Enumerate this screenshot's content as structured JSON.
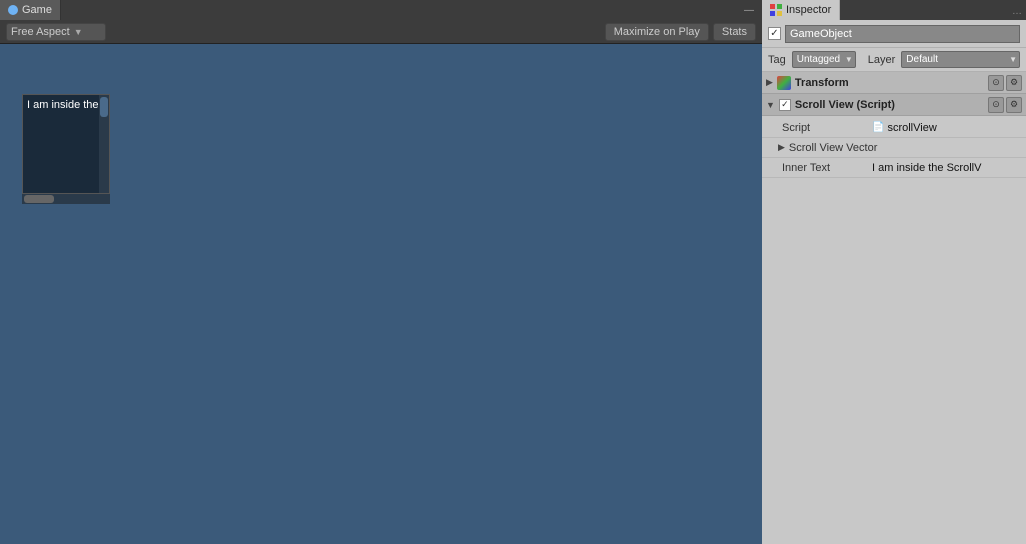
{
  "game_panel": {
    "tab_label": "Game",
    "aspect_label": "Free Aspect",
    "maximize_btn": "Maximize on Play",
    "stats_btn": "Stats",
    "minimize_symbol": "—",
    "scroll_text": "I am inside the"
  },
  "inspector_panel": {
    "tab_label": "Inspector",
    "minimize_symbol": "…",
    "gameobject_name": "GameObject",
    "tag_label": "Tag",
    "tag_value": "Untagged",
    "layer_label": "Layer",
    "layer_value": "Default",
    "transform": {
      "title": "Transform",
      "settings_btn": "⚙"
    },
    "scroll_view_script": {
      "title": "Scroll View (Script)",
      "script_label": "Script",
      "script_value": "scrollView",
      "scroll_view_vector_label": "Scroll View Vector",
      "inner_text_label": "Inner Text",
      "inner_text_value": "I am inside the ScrollV"
    }
  }
}
